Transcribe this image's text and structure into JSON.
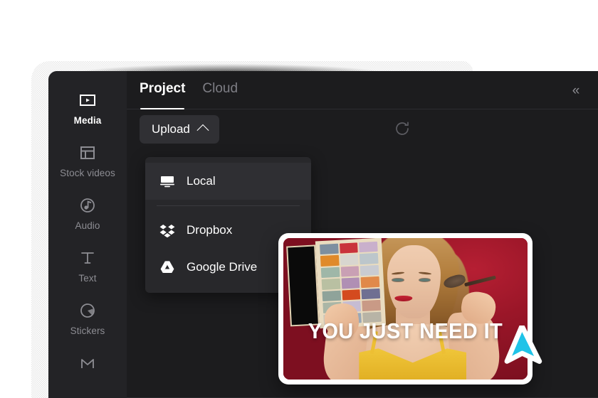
{
  "app": {
    "theme_bg": "#1c1c1e",
    "rail_bg": "#232326",
    "accent": "#ffffff",
    "cursor_color": "#1fc3e8"
  },
  "sidebar": {
    "items": [
      {
        "label": "Media",
        "icon": "media-video-icon",
        "active": true
      },
      {
        "label": "Stock videos",
        "icon": "layout-grid-icon",
        "active": false
      },
      {
        "label": "Audio",
        "icon": "audio-note-icon",
        "active": false
      },
      {
        "label": "Text",
        "icon": "text-t-icon",
        "active": false
      },
      {
        "label": "Stickers",
        "icon": "sticker-pie-icon",
        "active": false
      },
      {
        "label": "",
        "icon": "effects-icon",
        "active": false
      }
    ]
  },
  "tabs": {
    "items": [
      {
        "label": "Project",
        "active": true
      },
      {
        "label": "Cloud",
        "active": false
      }
    ],
    "collapse_icon": "chevron-double-left-icon",
    "collapse_glyph": "«"
  },
  "toolbar": {
    "upload_label": "Upload",
    "upload_chevron": "chevron-up-icon",
    "refresh_icon": "refresh-icon"
  },
  "upload_menu": {
    "open": true,
    "items": [
      {
        "label": "Local",
        "icon": "monitor-icon",
        "hover": true,
        "divider_after": true
      },
      {
        "label": "Dropbox",
        "icon": "dropbox-icon",
        "hover": false,
        "divider_after": false
      },
      {
        "label": "Google Drive",
        "icon": "google-drive-icon",
        "hover": false,
        "divider_after": false
      }
    ]
  },
  "media_card": {
    "caption": "YOU JUST NEED IT",
    "background_color": "#9a1628",
    "frame_color": "#ffffff",
    "palette_swatches": [
      "#7d8fa0",
      "#c9333b",
      "#c9b0cc",
      "#e08a2a",
      "#d8d6cf",
      "#bcc6cb",
      "#9fb7a8",
      "#c9a0b4",
      "#c9cbd2",
      "#b9c0a2",
      "#b08fb4",
      "#e0894a",
      "#8fa39a",
      "#d44a1e",
      "#6f6f92",
      "#aab6a6",
      "#c6bcd2",
      "#c99a86",
      "#c8c7bd",
      "#9aa8b6",
      "#b8b4a6"
    ]
  },
  "cursor": {
    "icon": "pointer-arrow-cursor",
    "fill": "#1fc3e8",
    "stroke": "#ffffff"
  }
}
